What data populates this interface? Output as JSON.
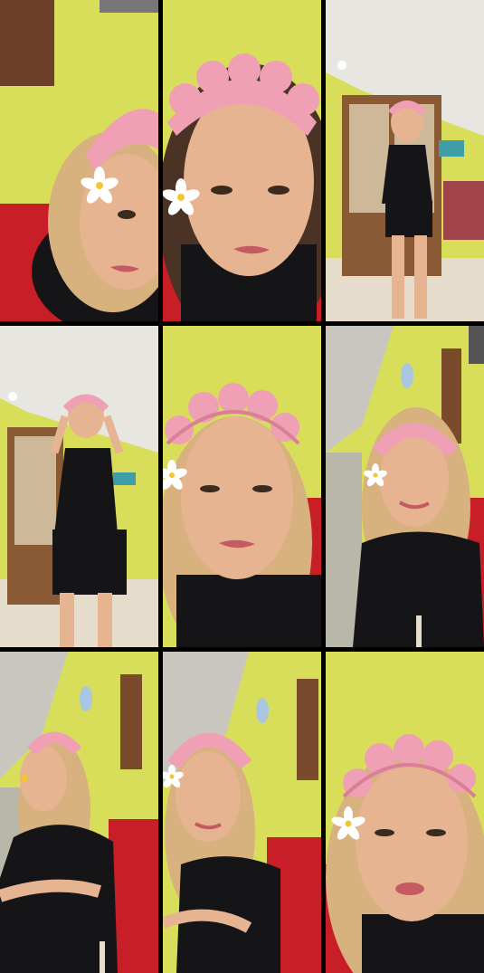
{
  "colors": {
    "grid_gap": "#000000",
    "wall_yellow": "#d8de5a",
    "wall_yellow_shadow": "#b9bf45",
    "ceiling": "#e8e6e0",
    "floor": "#e6dccb",
    "sofa_red": "#c81e28",
    "skin": "#e7b492",
    "skin_shadow": "#c98f70",
    "hair_blonde": "#d7b27e",
    "hair_dark": "#4a3324",
    "headband_pink": "#efa0b4",
    "headband_pink_dark": "#d97f97",
    "shirt_black": "#151517",
    "lips": "#c45a62",
    "cabinet_wood": "#8a5a35",
    "flower_white": "#ffffff",
    "flower_center": "#f2c531"
  },
  "tiles": [
    {
      "scene": "close-up-sofa"
    },
    {
      "scene": "extreme-close-up"
    },
    {
      "scene": "full-body-cabinet"
    },
    {
      "scene": "full-body-hands-up"
    },
    {
      "scene": "close-up-sofa"
    },
    {
      "scene": "medium-shot-wall"
    },
    {
      "scene": "medium-shot-side"
    },
    {
      "scene": "medium-shot-wall"
    },
    {
      "scene": "close-up-sofa"
    }
  ],
  "icons": {
    "flower": "plumeria-flower-icon",
    "lamp": "ceiling-light-icon"
  }
}
